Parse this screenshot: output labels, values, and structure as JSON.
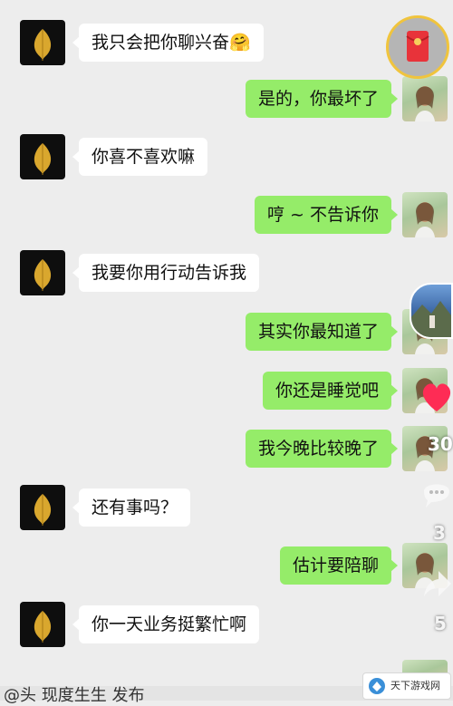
{
  "messages": [
    {
      "side": "left",
      "text": "我只会把你聊兴奋🤗"
    },
    {
      "side": "right",
      "text": "是的，你最坏了"
    },
    {
      "side": "left",
      "text": "你喜不喜欢嘛"
    },
    {
      "side": "right",
      "text": "哼 ~ 不告诉你"
    },
    {
      "side": "left",
      "text": "我要你用行动告诉我"
    },
    {
      "side": "right",
      "text": "其实你最知道了"
    },
    {
      "side": "right",
      "text": "你还是睡觉吧"
    },
    {
      "side": "right",
      "text": "我今晚比较晚了"
    },
    {
      "side": "left",
      "text": "还有事吗？"
    },
    {
      "side": "right",
      "text": "估计要陪聊"
    },
    {
      "side": "left",
      "text": "你一天业务挺繁忙啊"
    }
  ],
  "overlay": {
    "like_count": "30",
    "comment_count": "3",
    "share_count": "5",
    "bottom_caption": "@头 现度生生 发布",
    "watermark": "天下游戏网",
    "heart_color": "#fe2c55"
  },
  "colors": {
    "background": "#ededed",
    "incoming_bubble": "#ffffff",
    "outgoing_bubble": "#95ec69"
  }
}
